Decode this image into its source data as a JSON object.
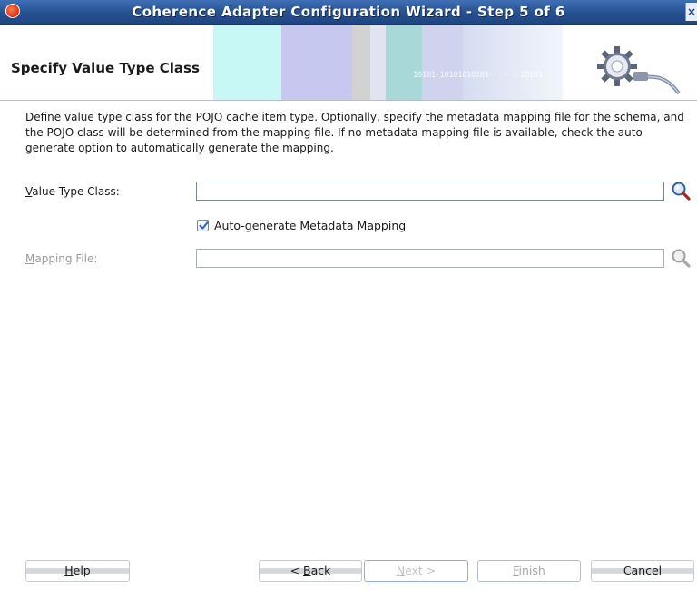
{
  "window": {
    "title": "Coherence Adapter Configuration Wizard - Step 5 of 6",
    "close_glyph": "×"
  },
  "header": {
    "step_title": "Specify Value Type Class",
    "decor_binary": "10101·10101010101·······10101"
  },
  "description": "Define value type class for the POJO cache item type. Optionally, specify the metadata mapping file for the schema, and the POJO class will be determined from the mapping file. If no metadata mapping file is available, check the auto-generate option to automatically generate the mapping.",
  "form": {
    "value_type_class": {
      "label_mnemonic": "V",
      "label_rest": "alue Type Class:",
      "value": "",
      "search_icon": "search-icon"
    },
    "auto_generate": {
      "label": "Auto-generate Metadata Mapping",
      "checked": true
    },
    "mapping_file": {
      "label_mnemonic": "M",
      "label_rest": "apping File:",
      "value": "",
      "enabled": false,
      "search_icon": "search-icon"
    }
  },
  "buttons": {
    "help": {
      "mnemonic": "H",
      "rest": "elp"
    },
    "back": {
      "prefix": "< ",
      "mnemonic": "B",
      "rest": "ack"
    },
    "next": {
      "mnemonic": "N",
      "rest": "ext >",
      "enabled": false
    },
    "finish": {
      "mnemonic": "F",
      "rest": "inish",
      "enabled": false
    },
    "cancel": {
      "label": "Cancel"
    }
  },
  "colors": {
    "titlebar": "#26508f",
    "accent_search": "#2e5fa8",
    "check_tick": "#2d63b8"
  }
}
